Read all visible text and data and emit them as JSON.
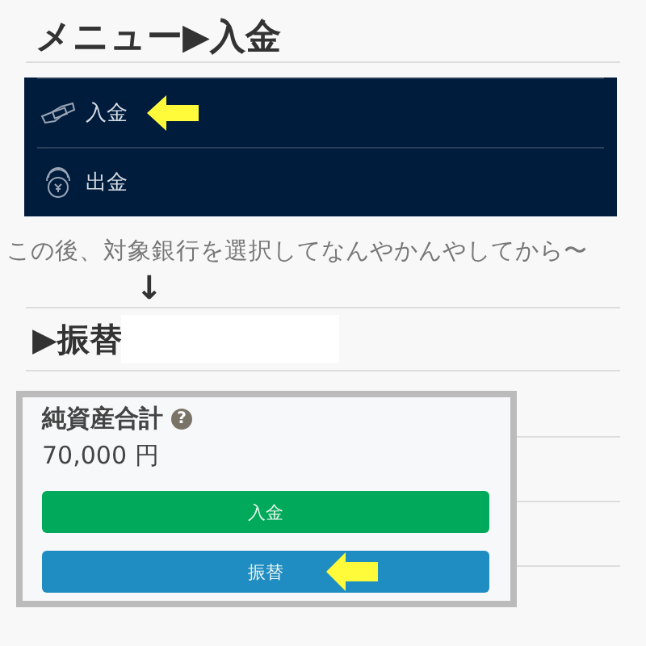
{
  "title": "メニュー▶入金",
  "menu": [
    {
      "label": "入金",
      "kind": "deposit",
      "pointed": true
    },
    {
      "label": "出金",
      "kind": "withdraw",
      "pointed": false
    }
  ],
  "caption": "この後、対象銀行を選択してなんやかんやしてから〜",
  "down_arrow": "↓",
  "subtitle": "▶振替",
  "card": {
    "label": "純資産合計",
    "help_icon": "?",
    "amount": "70,000 円",
    "buttons": [
      {
        "label": "入金",
        "kind": "green",
        "pointed": false
      },
      {
        "label": "振替",
        "kind": "blue",
        "pointed": true
      }
    ]
  }
}
